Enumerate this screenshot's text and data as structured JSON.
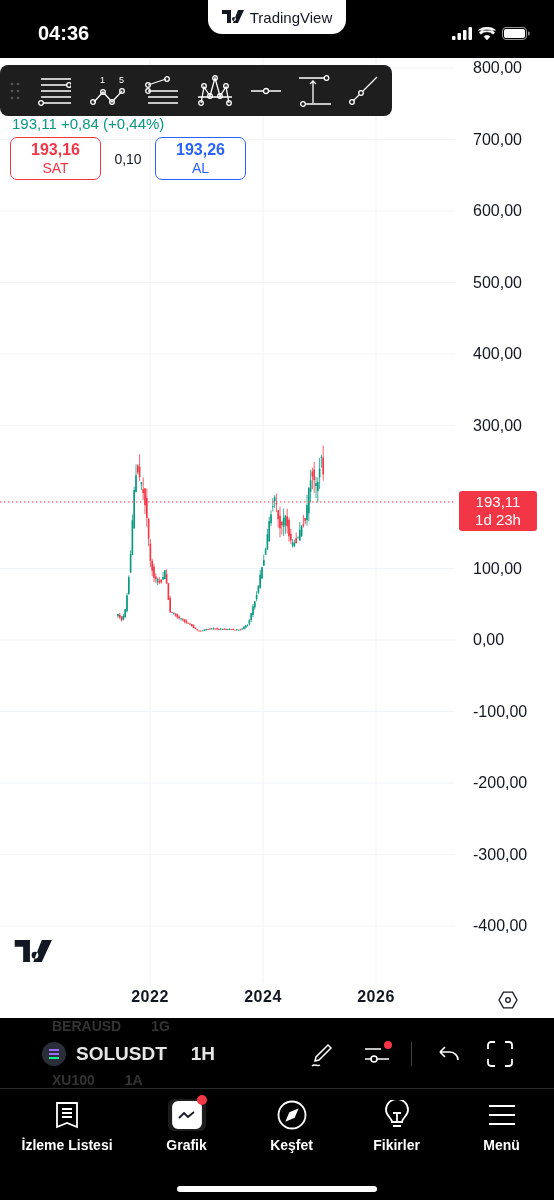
{
  "status_bar": {
    "time": "04:36",
    "banner": "TradingView"
  },
  "drawing_toolbar": [
    {
      "kind": "grip"
    },
    {
      "kind": "fib"
    },
    {
      "kind": "wave",
      "labels": [
        "1",
        "5"
      ]
    },
    {
      "kind": "pitchfork"
    },
    {
      "kind": "pattern"
    },
    {
      "kind": "hline"
    },
    {
      "kind": "measure"
    },
    {
      "kind": "trend"
    }
  ],
  "quote": {
    "change": "193,11 +0,84 (+0,44%)",
    "sell": {
      "price": "193,16",
      "label": "SAT"
    },
    "spread": "0,10",
    "buy": {
      "price": "193,26",
      "label": "AL"
    }
  },
  "y_axis": {
    "upper": [
      "800,00",
      "700,00",
      "600,00",
      "500,00",
      "400,00",
      "300,00"
    ],
    "lower": [
      "100,00",
      "0,00",
      "-100,00",
      "-200,00",
      "-300,00",
      "-400,00"
    ]
  },
  "price_label": {
    "price": "193,11",
    "countdown": "1d 23h"
  },
  "x_axis": [
    "2022",
    "2024",
    "2026"
  ],
  "symbol_bar": {
    "previous": {
      "symbol": "BERAUSD",
      "interval": "1G"
    },
    "symbol": "SOLUSDT",
    "interval": "1H",
    "next": {
      "symbol": "XU100",
      "interval": "1A"
    },
    "indicators_notification": true
  },
  "tabs": [
    {
      "kind": "watchlist",
      "label": "İzleme Listesi",
      "selected": false,
      "notification": false
    },
    {
      "kind": "chart",
      "label": "Grafik",
      "selected": true,
      "notification": true
    },
    {
      "kind": "explore",
      "label": "Keşfet",
      "selected": false,
      "notification": false
    },
    {
      "kind": "ideas",
      "label": "Fikirler",
      "selected": false,
      "notification": false
    },
    {
      "kind": "menu",
      "label": "Menü",
      "selected": false,
      "notification": false
    }
  ]
}
